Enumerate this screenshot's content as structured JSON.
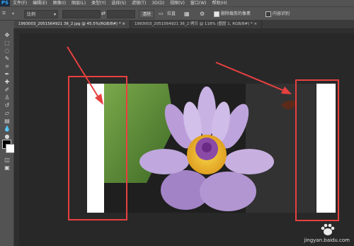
{
  "app": {
    "logo": "PS"
  },
  "menu": [
    "文件(F)",
    "编辑(E)",
    "图像(I)",
    "图层(L)",
    "类型(Y)",
    "选择(S)",
    "滤镜(T)",
    "3D(D)",
    "视图(V)",
    "窗口(W)",
    "帮助(H)"
  ],
  "options": {
    "ratio_value": "比例",
    "clear_label": "清除",
    "straighten_label": "拉直",
    "delete_cropped_label": "删除裁剪的像素",
    "delete_cropped_checked": true,
    "content_aware_label": "内容识别",
    "content_aware_checked": false
  },
  "tabs": [
    {
      "label": "1993003_2051564921 36_2.jpg @ 45.5%(RGB/8#) *",
      "active": true
    },
    {
      "label": "1993003_2051564921 36_2 拷贝 @ 118% (图层 1, RGB/8#) *",
      "active": false
    }
  ],
  "watermark": "jingyan.baidu.com",
  "colors": {
    "accent_red": "#e84040"
  }
}
